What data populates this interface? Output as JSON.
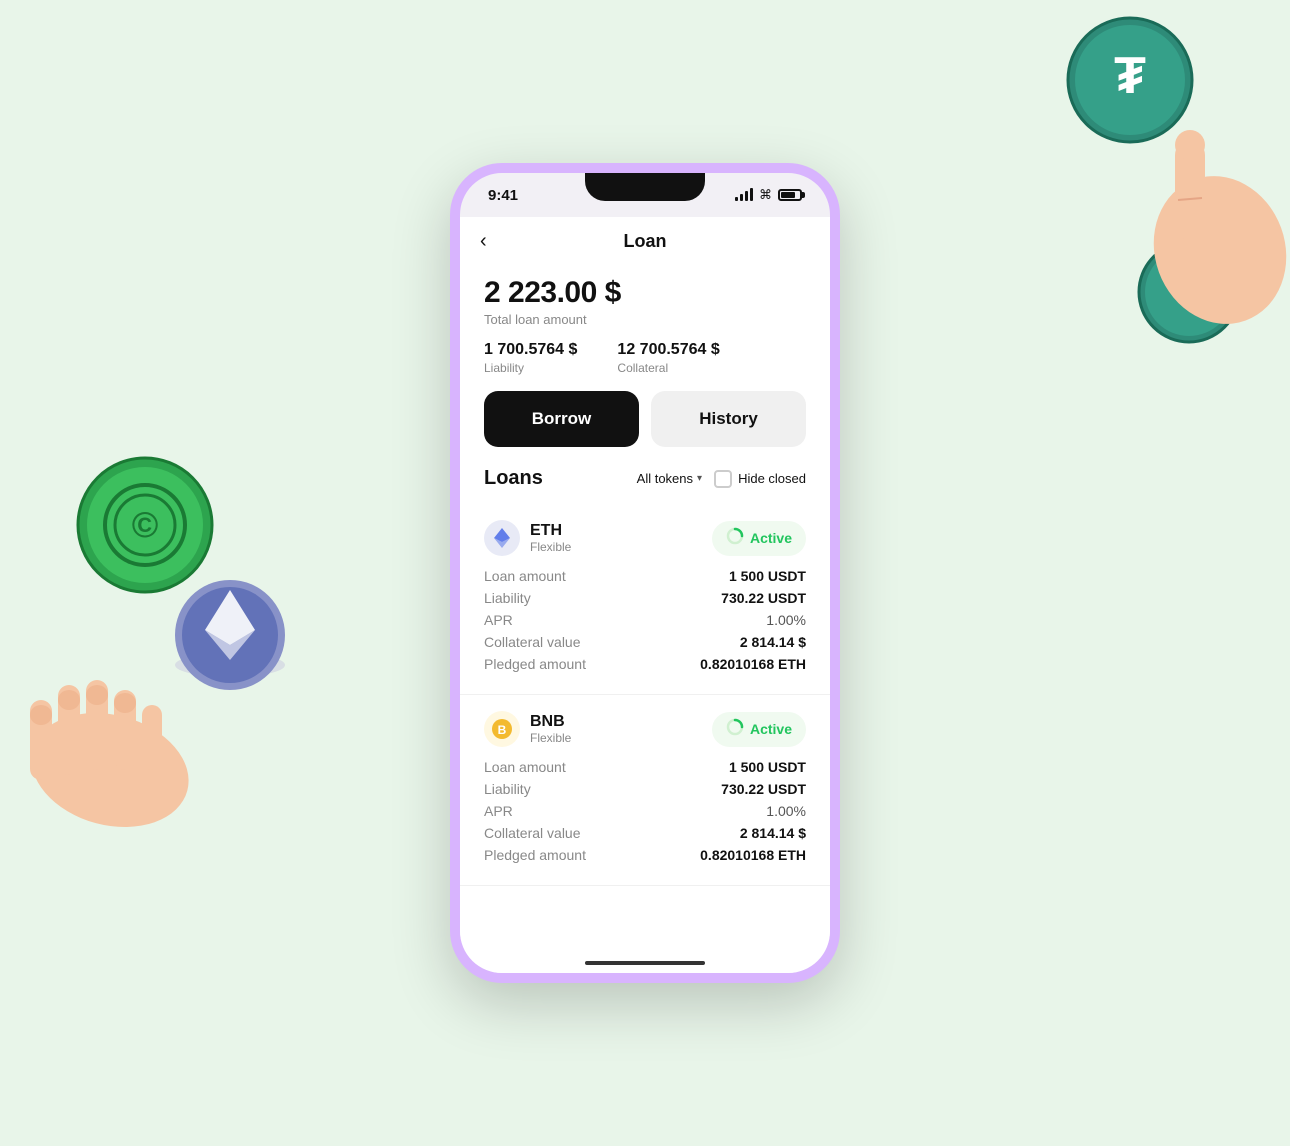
{
  "status_bar": {
    "time": "9:41",
    "battery_pct": 85
  },
  "header": {
    "back_label": "‹",
    "title": "Loan"
  },
  "loan_summary": {
    "total_amount": "2 223.00 $",
    "total_label": "Total loan amount",
    "liability_value": "1 700.5764 $",
    "liability_label": "Liability",
    "collateral_value": "12 700.5764 $",
    "collateral_label": "Collateral"
  },
  "tabs": {
    "borrow_label": "Borrow",
    "history_label": "History"
  },
  "loans_section": {
    "title": "Loans",
    "filter_label": "All tokens",
    "hide_closed_label": "Hide closed"
  },
  "loan_cards": [
    {
      "token": "ETH",
      "type": "Flexible",
      "status": "Active",
      "rows": [
        {
          "key": "Loan amount",
          "value": "1 500 USDT"
        },
        {
          "key": "Liability",
          "value": "730.22 USDT"
        },
        {
          "key": "APR",
          "value": "1.00%"
        },
        {
          "key": "Collateral value",
          "value": "2 814.14 $"
        },
        {
          "key": "Pledged amount",
          "value": "0.82010168 ETH"
        }
      ]
    },
    {
      "token": "BNB",
      "type": "Flexible",
      "status": "Active",
      "rows": [
        {
          "key": "Loan amount",
          "value": "1 500 USDT"
        },
        {
          "key": "Liability",
          "value": "730.22 USDT"
        },
        {
          "key": "APR",
          "value": "1.00%"
        },
        {
          "key": "Collateral value",
          "value": "2 814.14 $"
        },
        {
          "key": "Pledged amount",
          "value": "0.82010168 ETH"
        }
      ]
    }
  ],
  "colors": {
    "active_green": "#22c55e",
    "phone_border": "#d8b4fe",
    "tab_active_bg": "#111111",
    "tab_inactive_bg": "#f0f0f0"
  }
}
